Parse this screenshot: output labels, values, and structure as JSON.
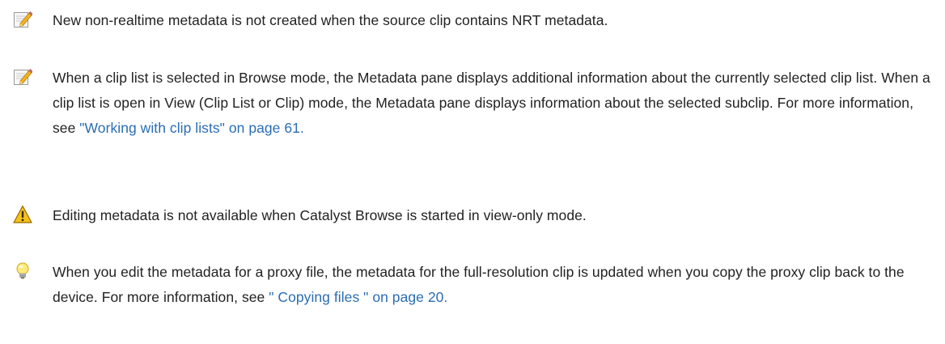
{
  "notes": [
    {
      "icon": "note-pencil-icon",
      "text": "New non-realtime metadata is not created when the source clip contains NRT metadata."
    },
    {
      "icon": "note-pencil-icon",
      "text_before": "When a clip list is selected in Browse mode, the Metadata pane displays additional information about the currently selected clip list. When a clip list is open in View (Clip List or Clip) mode, the Metadata pane displays information about the selected subclip. For more information, see ",
      "link": "\"Working with clip lists\" on page 61.",
      "text_after": ""
    },
    {
      "icon": "warning-icon",
      "text": "Editing metadata is not available when Catalyst Browse is started in view-only mode."
    },
    {
      "icon": "lightbulb-tip-icon",
      "text_before": "When you edit the metadata for a proxy file, the metadata for the full-resolution clip is updated when you copy the proxy clip back to the device. For more information, see ",
      "link": "\" Copying files \" on page 20.",
      "text_after": ""
    }
  ],
  "colors": {
    "text": "#222222",
    "link": "#2b6db3",
    "warning_fill": "#f4c21b",
    "tip_bulb": "#ffe97a"
  }
}
